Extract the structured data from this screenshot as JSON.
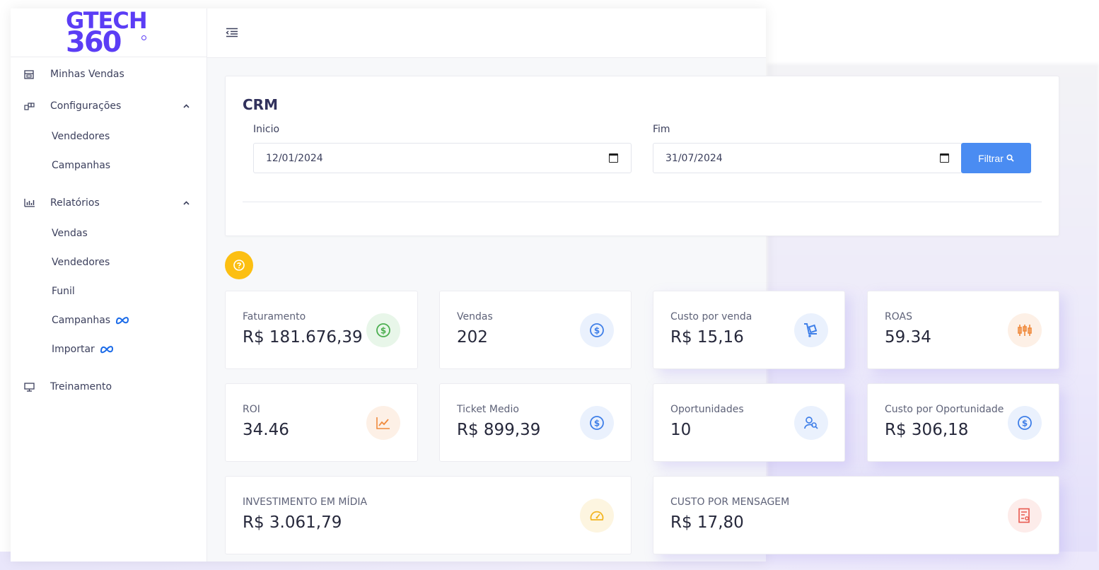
{
  "brand": {
    "line1": "GTECH",
    "line2": "360"
  },
  "sidebar": {
    "items": [
      {
        "label": "Minhas Vendas",
        "icon": "store-icon"
      },
      {
        "label": "Configurações",
        "icon": "config-icon",
        "expanded": true,
        "children": [
          {
            "label": "Vendedores"
          },
          {
            "label": "Campanhas"
          }
        ]
      },
      {
        "label": "Relatórios",
        "icon": "bar-chart-icon",
        "expanded": true,
        "children": [
          {
            "label": "Vendas"
          },
          {
            "label": "Vendedores"
          },
          {
            "label": "Funil"
          },
          {
            "label": "Campanhas",
            "badge_icon": "meta-icon"
          },
          {
            "label": "Importar",
            "badge_icon": "meta-icon"
          }
        ]
      },
      {
        "label": "Treinamento",
        "icon": "monitor-icon"
      }
    ]
  },
  "topbar": {
    "toggle_icon": "menu-collapse-icon"
  },
  "crm": {
    "title": "CRM",
    "start": {
      "label": "Inicio",
      "value": "12/01/2024"
    },
    "end": {
      "label": "Fim",
      "value": "31/07/2024"
    },
    "filter_label": "Filtrar"
  },
  "help_icon": "question-icon",
  "kpis": [
    {
      "label": "Faturamento",
      "value": "R$ 181.676,39",
      "icon": "dollar-circle-icon",
      "color": "#4caf50",
      "bg": "#e8f6e9"
    },
    {
      "label": "Vendas",
      "value": "202",
      "icon": "dollar-circle-icon",
      "color": "#3f7fe8",
      "bg": "#eaf1fd"
    },
    {
      "label": "Custo por venda",
      "value": "R$ 15,16",
      "icon": "dolly-icon",
      "color": "#3f7fe8",
      "bg": "#eaf1fd"
    },
    {
      "label": "ROAS",
      "value": "59.34",
      "icon": "candlestick-icon",
      "color": "#f08a3c",
      "bg": "#fdf0e6"
    },
    {
      "label": "ROI",
      "value": "34.46",
      "icon": "line-chart-icon",
      "color": "#f08a3c",
      "bg": "#fdf0e6"
    },
    {
      "label": "Ticket Medio",
      "value": "R$ 899,39",
      "icon": "dollar-circle-icon",
      "color": "#3f7fe8",
      "bg": "#eaf1fd"
    },
    {
      "label": "Oportunidades",
      "value": "10",
      "icon": "user-search-icon",
      "color": "#3f7fe8",
      "bg": "#eaf1fd"
    },
    {
      "label": "Custo por Oportunidade",
      "value": "R$ 306,18",
      "icon": "dollar-circle-icon",
      "color": "#3f7fe8",
      "bg": "#eaf1fd"
    },
    {
      "label": "INVESTIMENTO EM MÍDIA",
      "value": "R$ 3.061,79",
      "icon": "speedometer-icon",
      "color": "#f2b521",
      "bg": "#fdf5e0"
    },
    {
      "label": "CUSTO POR MENSAGEM",
      "value": "R$ 17,80",
      "icon": "invoice-icon",
      "color": "#e8594f",
      "bg": "#fdecea"
    }
  ]
}
